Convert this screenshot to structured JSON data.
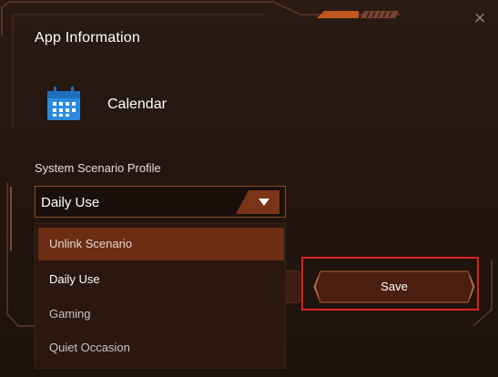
{
  "dialog": {
    "title": "App Information",
    "close_icon": "close-icon"
  },
  "app": {
    "name": "Calendar",
    "icon": "calendar-icon",
    "icon_color": "#2b8be0"
  },
  "profile": {
    "label": "System Scenario Profile",
    "selected": "Daily Use",
    "options": [
      "Unlink Scenario",
      "Daily Use",
      "Gaming",
      "Quiet Occasion"
    ],
    "highlighted_index": 0
  },
  "actions": {
    "save_label": "Save"
  },
  "colors": {
    "accent": "#c0571f",
    "highlight_item": "#6b2d13",
    "annotation_box": "#e0221b"
  }
}
